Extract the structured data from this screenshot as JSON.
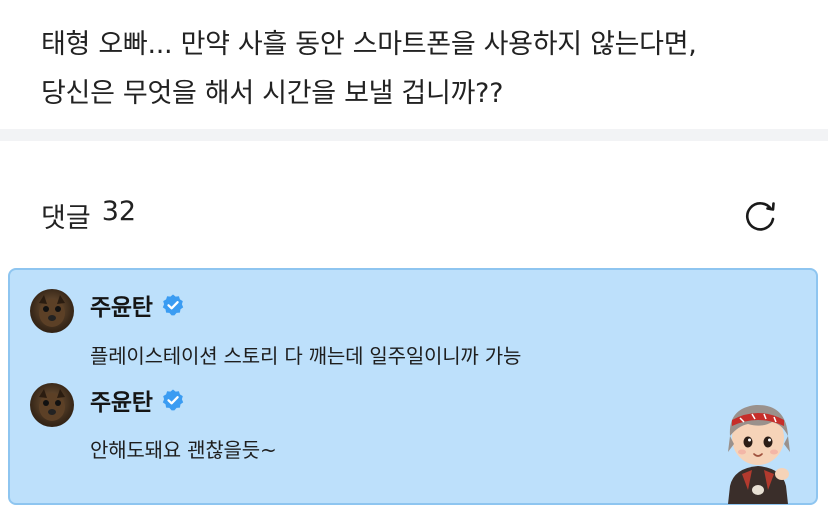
{
  "post": {
    "lines": [
      "태형 오빠... 만약 사흘 동안 스마트폰을 사용하지 않는다면,",
      "당신은 무엇을 해서 시간을 보낼 겁니까??"
    ]
  },
  "comments_section": {
    "label": "댓글",
    "count": "32",
    "refresh_icon": "refresh-icon"
  },
  "comments": [
    {
      "author": "주윤탄",
      "verified": true,
      "text": "플레이스테이션 스토리 다 깨는데 일주일이니까 가능"
    },
    {
      "author": "주윤탄",
      "verified": true,
      "text": "안해도돼요 괜찮을듯~"
    }
  ],
  "colors": {
    "highlight_bg": "#bde0fb",
    "highlight_border": "#8ec5f0",
    "verified_badge": "#3b9cf2",
    "divider": "#f2f3f5"
  }
}
